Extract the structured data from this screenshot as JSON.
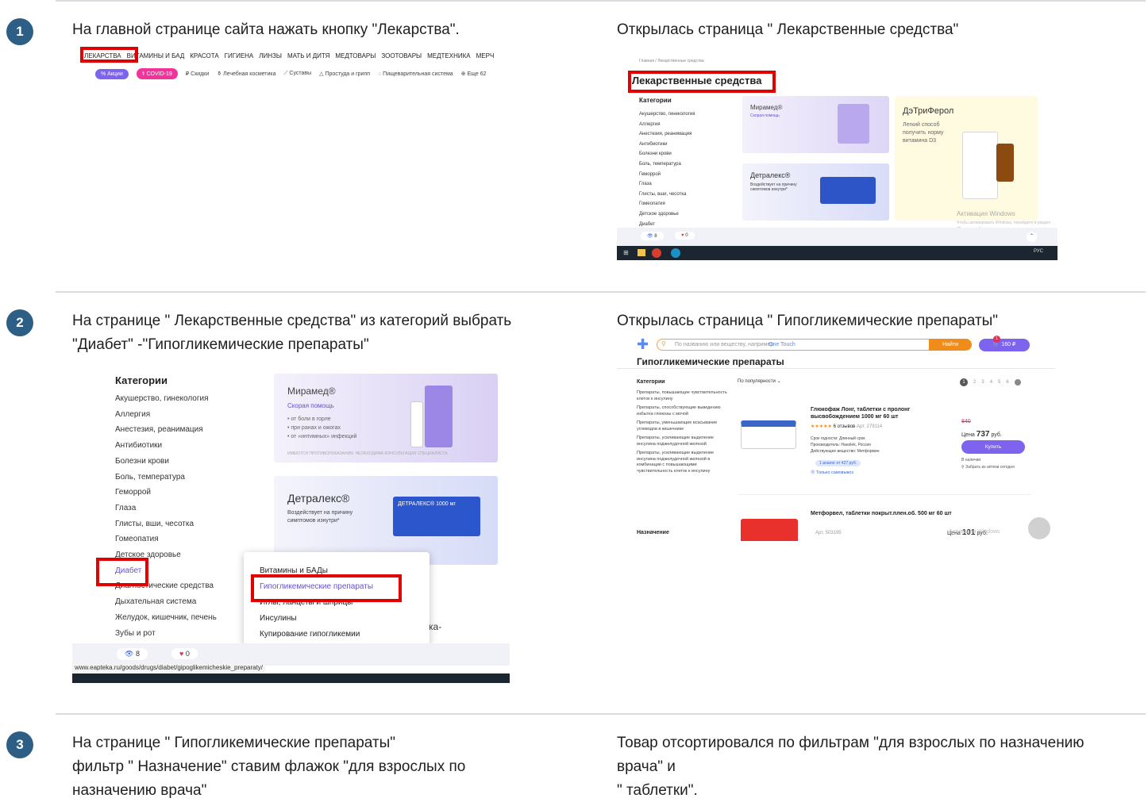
{
  "steps": [
    {
      "number": "1",
      "instruction": "На главной странице сайта нажать кнопку  \"Лекарства\".",
      "result": "Открылась страница \" Лекарственные средства\""
    },
    {
      "number": "2",
      "instruction_line1": "На странице  \" Лекарственные средства\" из категорий выбрать",
      "instruction_line2": "\"Диабет\" -\"Гипогликемические препараты\"",
      "result": "Открылась страница \" Гипогликемические препараты\""
    },
    {
      "number": "3",
      "instruction_line1": "На странице \" Гипогликемические препараты\"",
      "instruction_line2": "фильтр \" Назначение\" ставим флажок \"для взрослых по",
      "instruction_line3": "назначению врача\"",
      "result_line1": "Товар отсортировался по фильтрам \"для взрослых по назначению",
      "result_line2": "врача\"  и",
      "result_line3": "\" таблетки\"."
    }
  ],
  "shot1": {
    "nav": [
      "ЛЕКАРСТВА",
      "ВИТАМИНЫ И БАД",
      "КРАСОТА",
      "ГИГИЕНА",
      "ЛИНЗЫ",
      "МАТЬ И ДИТЯ",
      "МЕДТОВАРЫ",
      "ЗООТОВАРЫ",
      "МЕДТЕХНИКА",
      "МЕРЧ"
    ],
    "chips": [
      "Акции",
      "COVID-19",
      "Скидки",
      "Лечебная косметика",
      "Суставы",
      "Простуда и грипп",
      "Пищеварительная система",
      "Еще 62"
    ]
  },
  "shot2": {
    "breadcrumb": "Главная  /  Лекарственные средства",
    "title": "Лекарственные средства",
    "categories_heading": "Категории",
    "categories": [
      "Акушерство, гинекология",
      "Аллергия",
      "Анестезия, реанимация",
      "Антибиотики",
      "Болезни крови",
      "Боль, температура",
      "Геморрой",
      "Глаза",
      "Глисты, вши, чесотка",
      "Гомеопатия",
      "Детское здоровье",
      "Диабет"
    ],
    "miramed_title": "Мирамед®",
    "miramed_sub": "Скорая помощь",
    "detralex_title": "Детралекс®",
    "detralex_sub": "Воздействует на причину симптомов изнутри*",
    "dt_title": "ДэТриФерол",
    "dt_sub1": "Легкий способ",
    "dt_sub2": "получить норму",
    "dt_sub3": "витамина D3",
    "activation": "Активация Windows",
    "activation_sub": "Чтобы активировать Windows, перейдите в раздел \"Параметры\".",
    "views": "8",
    "likes": "0",
    "tray": "РУС"
  },
  "shot3": {
    "categories_heading": "Категории",
    "categories": [
      "Акушерство, гинекология",
      "Аллергия",
      "Анестезия, реанимация",
      "Антибиотики",
      "Болезни крови",
      "Боль, температура",
      "Геморрой",
      "Глаза",
      "Глисты, вши, чесотка",
      "Гомеопатия",
      "Детское здоровье",
      "Диабет",
      "Диагностические средства",
      "Дыхательная система",
      "Желудок, кишечник, печень",
      "Зубы и рот"
    ],
    "miramed_title": "Мирамед®",
    "miramed_sub": "Скорая помощь",
    "miramed_b1": "• от боли в горле",
    "miramed_b2": "• при ранах и ожогах",
    "miramed_b3": "• от «интимных» инфекций",
    "miramed_warn": "ИМЕЮТСЯ ПРОТИВОПОКАЗАНИЯ. НЕОБХОДИМА КОНСУЛЬТАЦИЯ СПЕЦИАЛИСТА",
    "detralex_title": "Детралекс®",
    "detralex_sub1": "Воздействует на причину",
    "detralex_sub2": "симптомов изнутри*",
    "detralex_box": "ДЕТРАЛЕКС® 1000 мг",
    "submenu": [
      "Витамины и БАДы",
      "Гипогликемические препараты",
      "Иглы, ланцеты и шприцы",
      "Инсулины",
      "Купирование гипогликемии"
    ],
    "side_text": "ка-",
    "views": "8",
    "likes": "0",
    "url": "www.eapteka.ru/goods/drugs/diabet/gipoglikemicheskie_preparaty/"
  },
  "shot4": {
    "search_placeholder": "По названию или веществу, например",
    "search_example": "One Touch",
    "search_button": "Найти",
    "cart": "160 ₽",
    "cart_count": "1",
    "title": "Гипогликемические препараты",
    "sort": "По популярности ⌄",
    "pages": [
      "1",
      "2",
      "3",
      "4",
      "5",
      "6"
    ],
    "categories_heading": "Категории",
    "filters": [
      "Препараты, повышающие чувствительность клеток к инсулину",
      "Препараты, способствующие выведению избытка глюкозы с мочой",
      "Препараты, уменьшающие всасывание углеводов в кишечнике",
      "Препараты, усиливающие выделение инсулина поджелудочной железой",
      "Препараты, усиливающие выделение инсулина поджелудочной железой в комбинации с повышающими чувствительность клеток к инсулину"
    ],
    "purpose_heading": "Назначение",
    "product1_name": "Глюкофаж Лонг, таблетки с пролонг высвобождением 1000 мг 60 шт",
    "product1_reviews": "6 отзывов",
    "product1_art": "Арт. 279114",
    "product1_old": "840",
    "product1_price_label": "Цена",
    "product1_price": "737",
    "product1_currency": "руб.",
    "product1_buy": "Купить",
    "product1_stock": "В наличии",
    "product1_pickup": "Забрать из аптеки сегодня",
    "product1_shelf": "Срок годности: Длинный срок",
    "product1_maker": "Производитель: Наноlek, Россия",
    "product1_substance": "Действующее вещество: Метформин",
    "product1_analog": "1 аналог от 427 руб.",
    "product1_pickup_only": "Только самовывоз",
    "product2_name": "Метфорвел, таблетки покрыт.плен.об. 500 мг 60 шт",
    "product2_art": "Арт. 503195",
    "product2_price_label": "Цена",
    "product2_price": "101",
    "product2_currency": "руб.",
    "activation": "Активация Windows"
  }
}
